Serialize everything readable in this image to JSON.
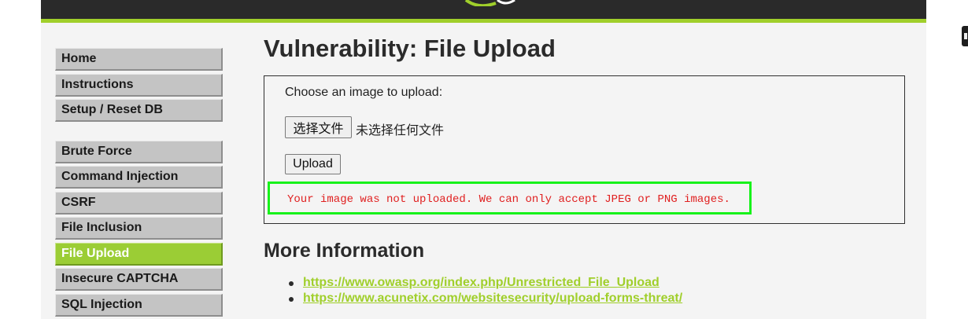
{
  "menu": {
    "items": [
      {
        "label": "Home",
        "group": 1
      },
      {
        "label": "Instructions",
        "group": 1
      },
      {
        "label": "Setup / Reset DB",
        "group": 1
      },
      {
        "label": "Brute Force",
        "group": 2
      },
      {
        "label": "Command Injection",
        "group": 2
      },
      {
        "label": "CSRF",
        "group": 2
      },
      {
        "label": "File Inclusion",
        "group": 2
      },
      {
        "label": "File Upload",
        "group": 2,
        "selected": true
      },
      {
        "label": "Insecure CAPTCHA",
        "group": 2
      },
      {
        "label": "SQL Injection",
        "group": 2
      }
    ]
  },
  "main": {
    "title": "Vulnerability: File Upload",
    "form": {
      "choose_label": "Choose an image to upload:",
      "file_button_label": "选择文件",
      "no_file_text": "未选择任何文件",
      "upload_button_label": "Upload",
      "error_message": "Your image was not uploaded. We can only accept JPEG or PNG images."
    },
    "more_info": {
      "title": "More Information",
      "links": [
        "https://www.owasp.org/index.php/Unrestricted_File_Upload",
        "https://www.acunetix.com/websitesecurity/upload-forms-threat/"
      ]
    }
  },
  "colors": {
    "header": "#2a2a2a",
    "accent": "#a0cf2b",
    "selected_menu": "#9bcd35",
    "error_text": "#e02020",
    "highlight_frame": "#17f21a"
  }
}
